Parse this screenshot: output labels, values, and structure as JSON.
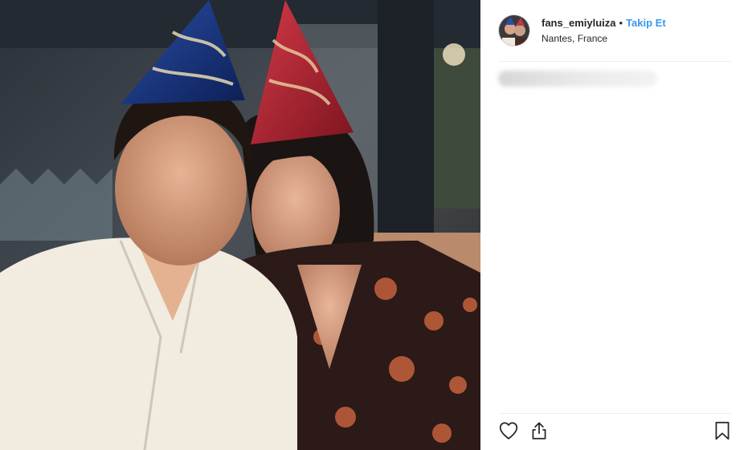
{
  "post": {
    "username": "fans_emiyluiza",
    "separator": "•",
    "follow_label": "Takip Et",
    "location": "Nantes, France",
    "caption_blurred": true
  },
  "icons": {
    "like": "heart-icon",
    "share": "share-icon",
    "save": "bookmark-icon"
  },
  "colors": {
    "follow_link": "#3897f0",
    "text": "#262626",
    "divider": "#efefef"
  }
}
